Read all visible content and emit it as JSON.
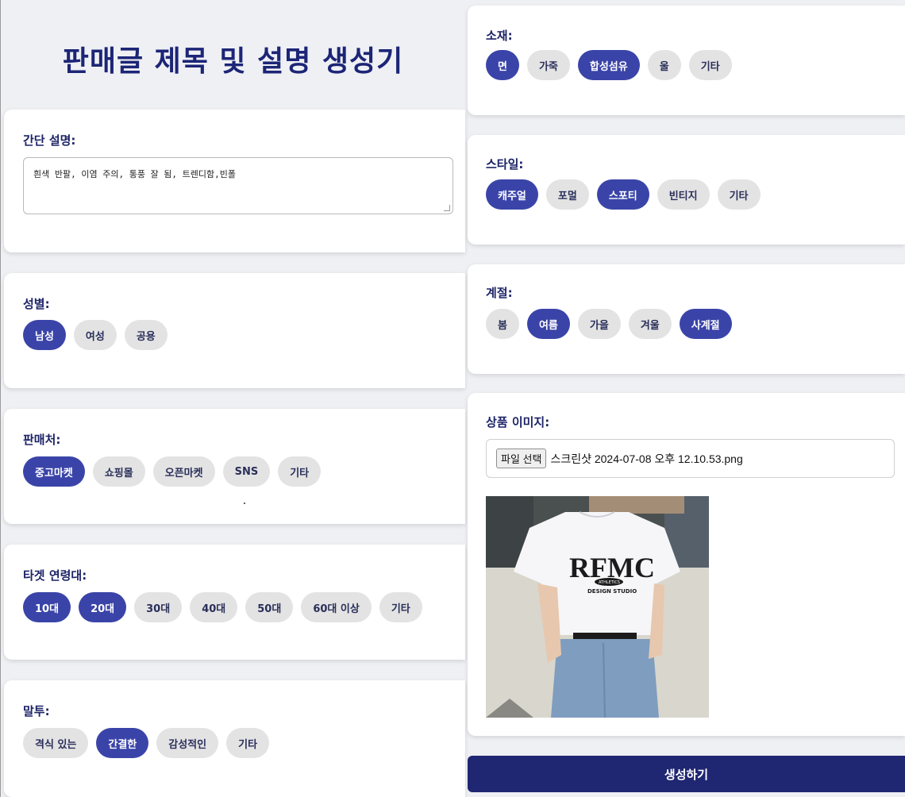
{
  "page_title": "판매글 제목 및 설명 생성기",
  "description": {
    "label": "간단 설명:",
    "value": "흰색 반팔, 이염 주의, 통풍 잘 됨, 트렌디함,빈폴"
  },
  "gender": {
    "label": "성별:",
    "options": [
      {
        "label": "남성",
        "selected": true
      },
      {
        "label": "여성",
        "selected": false
      },
      {
        "label": "공용",
        "selected": false
      }
    ]
  },
  "channel": {
    "label": "판매처:",
    "options": [
      {
        "label": "중고마켓",
        "selected": true
      },
      {
        "label": "쇼핑몰",
        "selected": false
      },
      {
        "label": "오픈마켓",
        "selected": false
      },
      {
        "label": "SNS",
        "selected": false
      },
      {
        "label": "기타",
        "selected": false
      }
    ]
  },
  "age": {
    "label": "타겟 연령대:",
    "options": [
      {
        "label": "10대",
        "selected": true
      },
      {
        "label": "20대",
        "selected": true
      },
      {
        "label": "30대",
        "selected": false
      },
      {
        "label": "40대",
        "selected": false
      },
      {
        "label": "50대",
        "selected": false
      },
      {
        "label": "60대 이상",
        "selected": false
      },
      {
        "label": "기타",
        "selected": false
      }
    ]
  },
  "tone": {
    "label": "말투:",
    "options": [
      {
        "label": "격식 있는",
        "selected": false
      },
      {
        "label": "간결한",
        "selected": true
      },
      {
        "label": "감성적인",
        "selected": false
      },
      {
        "label": "기타",
        "selected": false
      }
    ]
  },
  "material": {
    "label": "소재:",
    "options": [
      {
        "label": "면",
        "selected": true
      },
      {
        "label": "가죽",
        "selected": false
      },
      {
        "label": "합성섬유",
        "selected": true
      },
      {
        "label": "울",
        "selected": false
      },
      {
        "label": "기타",
        "selected": false
      }
    ]
  },
  "style": {
    "label": "스타일:",
    "options": [
      {
        "label": "캐주얼",
        "selected": true
      },
      {
        "label": "포멀",
        "selected": false
      },
      {
        "label": "스포티",
        "selected": true
      },
      {
        "label": "빈티지",
        "selected": false
      },
      {
        "label": "기타",
        "selected": false
      }
    ]
  },
  "season": {
    "label": "계절:",
    "options": [
      {
        "label": "봄",
        "selected": false
      },
      {
        "label": "여름",
        "selected": true
      },
      {
        "label": "가을",
        "selected": false
      },
      {
        "label": "겨울",
        "selected": false
      },
      {
        "label": "사계절",
        "selected": true
      }
    ]
  },
  "image": {
    "label": "상품 이미지:",
    "button_label": "파일 선택",
    "file_name": "스크린샷 2024-07-08 오후 12.10.53.png",
    "shirt_text": "RFMC",
    "shirt_badge": "ATHLETICS",
    "shirt_subtext": "DESIGN STUDIO"
  },
  "submit_label": "생성하기",
  "colors": {
    "accent": "#3a44a8",
    "primary_button": "#1f2672",
    "chip_inactive": "#e3e3e3",
    "background": "#eff0f4"
  }
}
